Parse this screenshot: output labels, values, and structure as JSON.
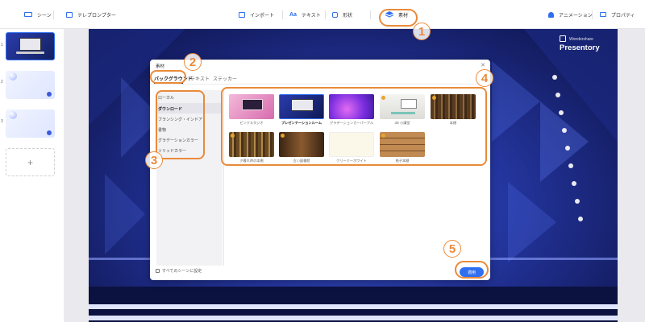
{
  "toolbar": {
    "scene_label": "シーン",
    "teleprompter_label": "テレプロンプター",
    "import_label": "インポート",
    "text_label": "テキスト",
    "shape_label": "形状",
    "material_label": "素材",
    "animation_label": "アニメーション",
    "property_label": "プロパティ"
  },
  "scenes": {
    "numbers": [
      "1",
      "2",
      "3"
    ],
    "add_symbol": "+"
  },
  "stage": {
    "logo_small": "Wondershare",
    "logo_big": "Presentory"
  },
  "dialog": {
    "title": "素材",
    "tabs": [
      "バックグラウンド",
      "テキスト",
      "ステッカー"
    ],
    "sidebar": [
      "ローカル",
      "ダウンロード",
      "ブランシング・インドア",
      "書物",
      "グラデーションカラー",
      "ソリッドカラー"
    ],
    "cards": [
      {
        "label": "ピンクスタジオ"
      },
      {
        "label": "プレゼンテーションルーム"
      },
      {
        "label": "グラデーションカーパープル"
      },
      {
        "label": "3D 小講堂"
      },
      {
        "label": "本棚"
      },
      {
        "label": "夕暮れ時の本棚"
      },
      {
        "label": "古い図書館"
      },
      {
        "label": "クリーミーホワイト"
      },
      {
        "label": "格子本棚"
      }
    ],
    "apply_all": "すべてのシーンに設定",
    "apply_button": "適用"
  },
  "annotations": [
    "1",
    "2",
    "3",
    "4",
    "5"
  ],
  "colors": {
    "accent": "#2f6ff0",
    "annotation": "#ea8a3a",
    "stage": "#2436a0"
  }
}
